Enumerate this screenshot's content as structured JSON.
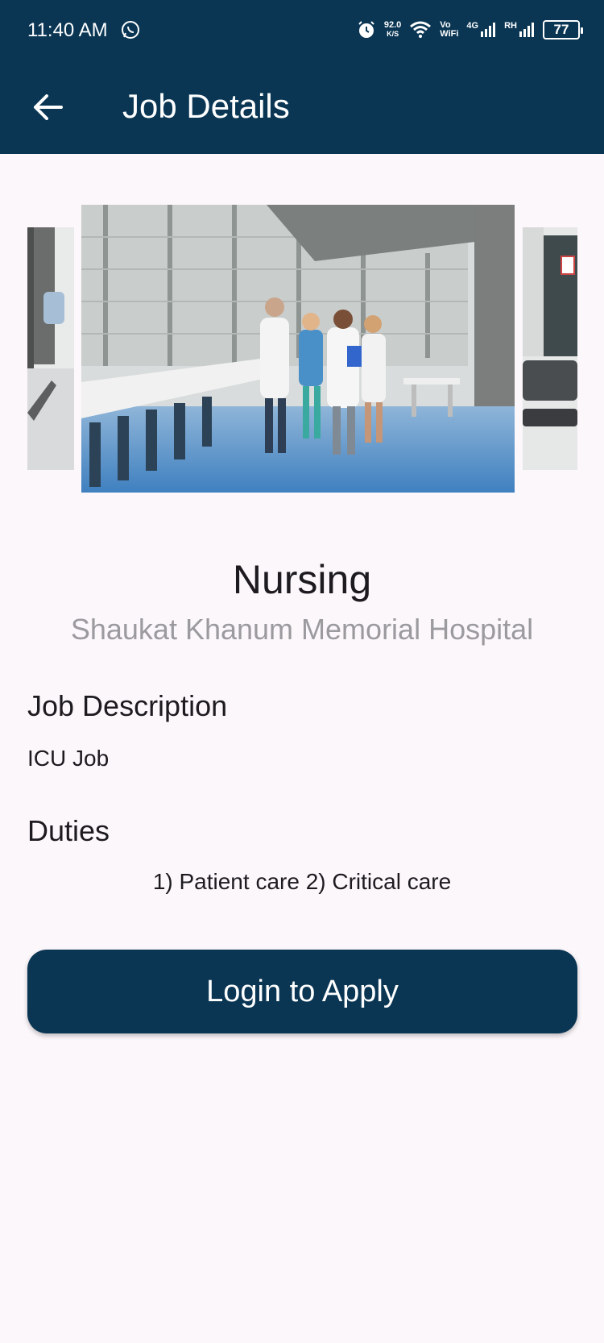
{
  "status_bar": {
    "time": "11:40 AM",
    "speed_value": "92.0",
    "speed_unit": "K/S",
    "vo": "Vo",
    "wifi": "WiFi",
    "net1": "4G",
    "net2": "RH",
    "battery": "77"
  },
  "app_bar": {
    "title": "Job Details"
  },
  "job": {
    "title": "Nursing",
    "company": "Shaukat Khanum Memorial Hospital",
    "description_heading": "Job Description",
    "description": "ICU Job",
    "duties_heading": "Duties",
    "duties": "1) Patient care 2) Critical care"
  },
  "actions": {
    "apply_label": "Login to Apply"
  },
  "colors": {
    "primary": "#0a3654",
    "background": "#fcf7fb",
    "subtitle": "#9b9a9e"
  }
}
